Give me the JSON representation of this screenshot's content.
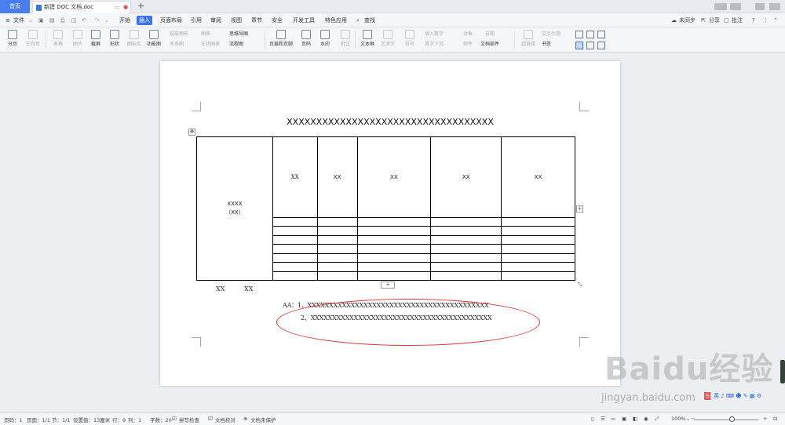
{
  "tabs": {
    "home": "首页",
    "document": "新建 DOC 文档.doc",
    "new_tab": "+"
  },
  "menu": {
    "file": "文件",
    "items": [
      "开始",
      "插入",
      "页面布局",
      "引用",
      "审阅",
      "视图",
      "章节",
      "安全",
      "开发工具",
      "特色应用"
    ],
    "active": "插入",
    "search": "查找",
    "sync": "未同步",
    "share": "分享",
    "comment": "批注",
    "help": "?"
  },
  "toolbar": {
    "page_break": "分页",
    "blank_page": "空白页",
    "table": "表格",
    "picture": "图片",
    "screenshot": "截屏",
    "shape": "形状",
    "icon_lib": "图标库",
    "function_chart": "功能图",
    "smart_shape": "智能图形",
    "chart": "图表",
    "mind_map": "思维导图",
    "relation_map": "关系图",
    "online_chart": "在线图表",
    "flowchart": "流程图",
    "header_footer": "页眉和页脚",
    "page_number": "页码",
    "watermark": "水印",
    "annotation": "批注",
    "textbox": "文本框",
    "wordart": "艺术字",
    "symbol": "符号",
    "formula": "公式",
    "insert_number": "插入数字",
    "first_drop": "首字下沉",
    "attachment": "附件",
    "date": "日期",
    "doc_parts": "文档部件",
    "object": "对象",
    "hyperlink": "超链接",
    "cross_ref": "交叉引用",
    "bookmark": "书签"
  },
  "document": {
    "title": "XXXXXXXXXXXXXXXXXXXXXXXXXXXXXXXXXXX",
    "merged_cell": [
      "XXXX",
      "（XX）"
    ],
    "header_row": [
      "XX",
      "XX",
      "XX",
      "XX",
      "XX"
    ],
    "under_table_left": "XX",
    "under_table_right": "XX",
    "note_line1": "AA：1、XXXXXXXXXXXXXXXXXXXXXXXXXXXXXXXXXXXXXXXXXX",
    "note_line2": "2、XXXXXXXXXXXXXXXXXXXXXXXXXXXXXXXXXXXXXXXXXX"
  },
  "status": {
    "page": "页码：1",
    "pages": "页面：1/1",
    "section": "节：1/1",
    "setting": "设置值：13厘米",
    "row": "行：9",
    "col": "列：1",
    "words": "字数：20",
    "spell": "拼写检查",
    "proof": "文档校对",
    "protect": "文档未保护",
    "zoom": "100%"
  },
  "watermark": {
    "brand": "Baidu经验",
    "url": "jingyan.baidu.com"
  },
  "colors": {
    "accent": "#3c75e3",
    "ellipse": "#dd3333"
  }
}
